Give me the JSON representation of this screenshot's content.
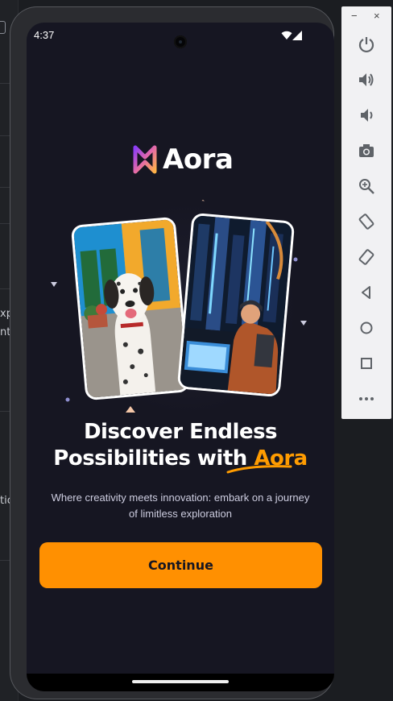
{
  "status_bar": {
    "time": "4:37"
  },
  "app": {
    "logo_text": "Aora"
  },
  "headline": {
    "line1": "Discover Endless",
    "line2_prefix": "Possibilities with ",
    "line2_accent": "Aora"
  },
  "subtext": "Where creativity meets innovation: embark on a journey of limitless exploration",
  "continue_button": {
    "label": "Continue"
  },
  "desktop": {
    "left_fragments": [
      "xp",
      "nt",
      "tic"
    ]
  },
  "emulator_toolbar": {
    "window_controls": [
      "−",
      "×"
    ],
    "buttons": [
      "power-icon",
      "volume-up-icon",
      "volume-down-icon",
      "camera-icon",
      "zoom-icon",
      "rotate-left-icon",
      "rotate-right-icon",
      "back-icon",
      "home-icon",
      "overview-icon",
      "more-icon"
    ]
  },
  "colors": {
    "background": "#161622",
    "accent": "#ff9c01",
    "button": "#ff9001",
    "text": "#ffffff",
    "subtext": "#cdcde0"
  }
}
